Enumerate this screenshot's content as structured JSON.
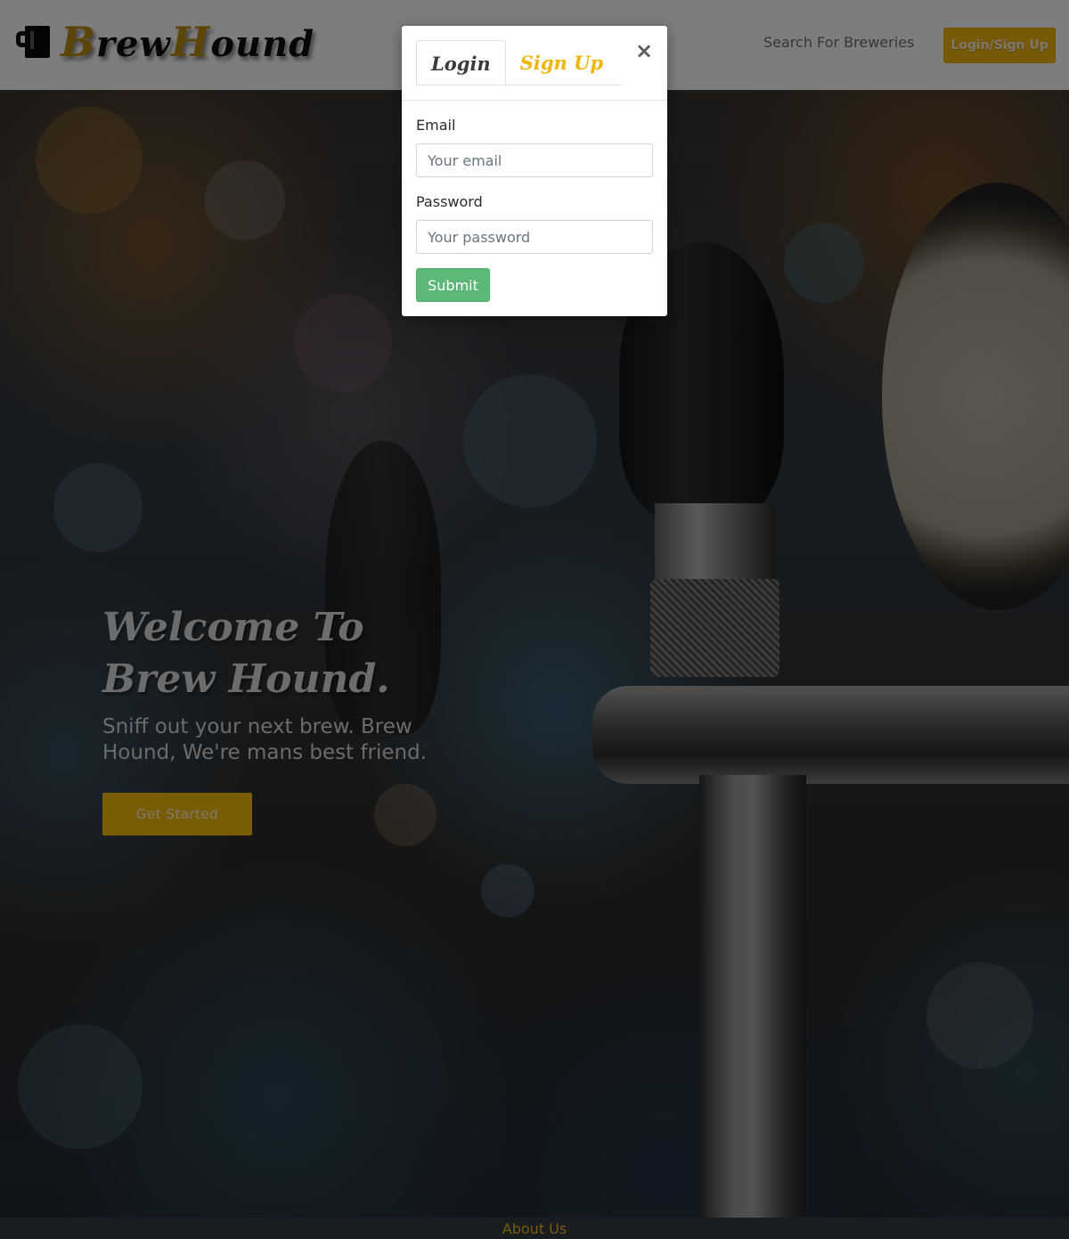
{
  "navbar": {
    "brand_prefix_1": "B",
    "brand_rest_1": "rew",
    "brand_prefix_2": "H",
    "brand_rest_2": "ound",
    "search_link": "Search For Breweries",
    "login_button": "Login/Sign Up"
  },
  "hero": {
    "title_line_1": "Welcome To",
    "title_line_2": "Brew Hound.",
    "subtitle": "Sniff out your next brew. Brew Hound, We're mans best friend.",
    "cta": "Get Started"
  },
  "footer": {
    "link": "About Us"
  },
  "modal": {
    "tabs": [
      {
        "label": "Login",
        "active": true
      },
      {
        "label": "Sign Up",
        "active": false
      }
    ],
    "close_icon": "×",
    "email_label": "Email",
    "email_placeholder": "Your email",
    "email_value": "",
    "password_label": "Password",
    "password_placeholder": "Your password",
    "password_value": "",
    "submit_label": "Submit"
  },
  "colors": {
    "accent_gold": "#f0b20e",
    "submit_green": "#5cb878",
    "footer_bg": "#333a40"
  }
}
